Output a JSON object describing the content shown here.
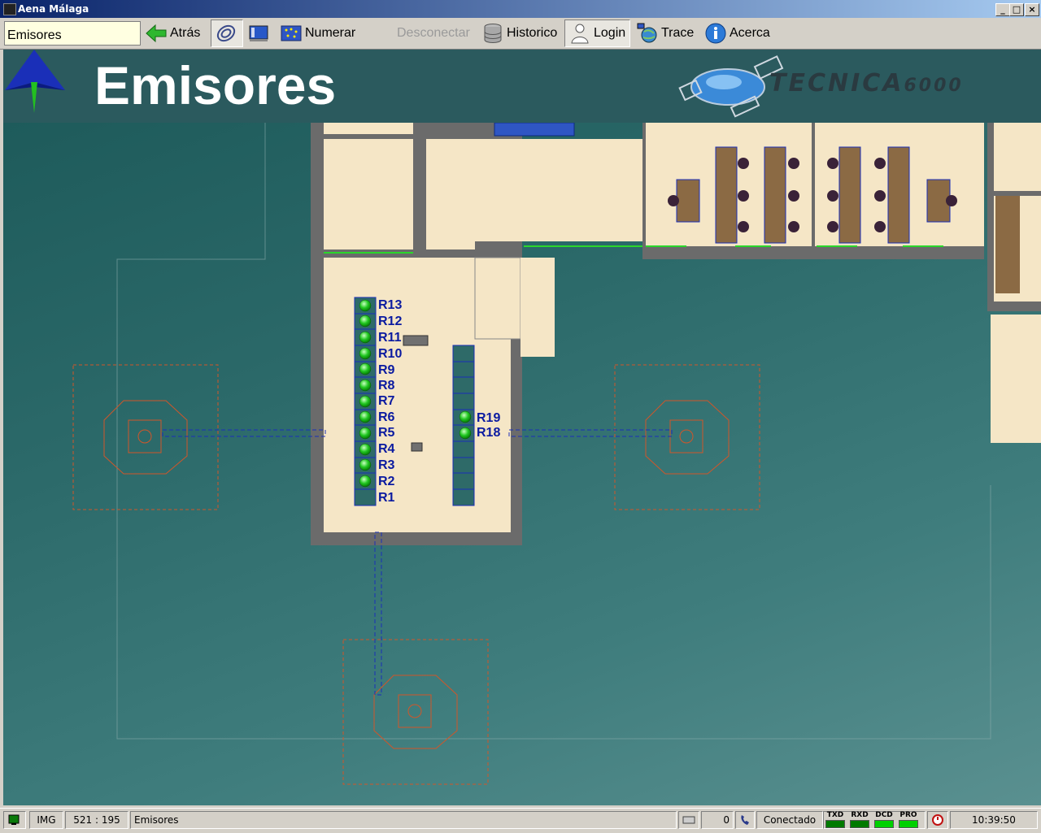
{
  "window": {
    "title": "Aena Málaga",
    "min": "_",
    "max": "□",
    "close": "×"
  },
  "toolbar": {
    "screen_value": "Emisores",
    "back": "Atrás",
    "number": "Numerar",
    "disconnect": "Desconectar",
    "history": "Historico",
    "login": "Login",
    "trace": "Trace",
    "about": "Acerca"
  },
  "header": {
    "title": "Emisores",
    "logo_text": "TECNICA",
    "logo_suffix": "6000"
  },
  "racks": {
    "left": [
      "R13",
      "R12",
      "R11",
      "R10",
      "R9",
      "R8",
      "R7",
      "R6",
      "R5",
      "R4",
      "R3",
      "R2",
      "R1"
    ],
    "right": [
      "R19",
      "R18"
    ]
  },
  "status": {
    "img": "IMG",
    "coords": "521 : 195",
    "screen": "Emisores",
    "count": "0",
    "connection": "Conectado",
    "led_txd": "TXD",
    "led_rxd": "RXD",
    "led_dcd": "DCD",
    "led_pro": "PRO",
    "time": "10:39:50"
  },
  "colors": {
    "header_bg": "#2b5a5e",
    "led_on": "#00c000",
    "led_dark": "#007a00",
    "rack_label": "#0a1aa0",
    "floor": "#f5e6c6"
  }
}
